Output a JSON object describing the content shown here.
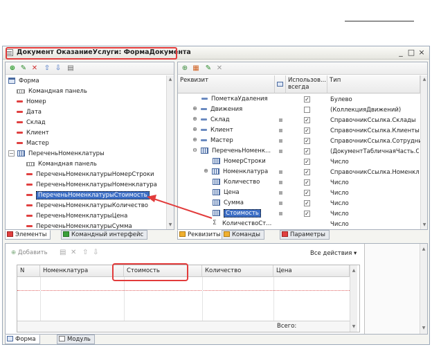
{
  "window": {
    "title": "Документ ОказаниеУслуги: ФормаДокумента",
    "minimize": "_",
    "maximize": "□",
    "close": "×"
  },
  "tree": {
    "items": [
      {
        "label": "Форма",
        "icon": "form-icon"
      },
      {
        "label": "Командная панель",
        "icon": "command-panel-icon"
      },
      {
        "label": "Номер",
        "icon": "field-icon"
      },
      {
        "label": "Дата",
        "icon": "field-icon"
      },
      {
        "label": "Склад",
        "icon": "field-icon"
      },
      {
        "label": "Клиент",
        "icon": "field-icon"
      },
      {
        "label": "Мастер",
        "icon": "field-icon"
      },
      {
        "label": "ПереченьНоменклатуры",
        "icon": "table-icon"
      },
      {
        "label": "Командная панель",
        "icon": "command-panel-icon"
      },
      {
        "label": "ПереченьНоменклатурыНомерСтроки",
        "icon": "field-icon"
      },
      {
        "label": "ПереченьНоменклатурыНоменклатура",
        "icon": "field-icon"
      },
      {
        "label": "ПереченьНоменклатурыСтоимость",
        "icon": "field-icon"
      },
      {
        "label": "ПереченьНоменклатурыКоличество",
        "icon": "field-icon"
      },
      {
        "label": "ПереченьНоменклатурыЦена",
        "icon": "field-icon"
      },
      {
        "label": "ПереченьНоменклатурыСумма",
        "icon": "field-icon"
      }
    ]
  },
  "left_tabs": {
    "elements": "Элементы",
    "command_interface": "Командный интерфейс"
  },
  "attributes": {
    "headers": {
      "name": "Реквизит",
      "use": "Использов... всегда",
      "type": "Тип"
    },
    "rows": [
      {
        "name": "ПометкаУдаления",
        "type": "Булево"
      },
      {
        "name": "Движения",
        "type": "(КоллекцияДвижений)"
      },
      {
        "name": "Склад",
        "type": "СправочникСсылка.Склады"
      },
      {
        "name": "Клиент",
        "type": "СправочникСсылка.Клиенты"
      },
      {
        "name": "Мастер",
        "type": "СправочникСсылка.Сотрудни..."
      },
      {
        "name": "ПереченьНоменк...",
        "type": "(ДокументТабличнаяЧасть.О..."
      },
      {
        "name": "НомерСтроки",
        "type": "Число"
      },
      {
        "name": "Номенклатура",
        "type": "СправочникСсылка.Номенкл..."
      },
      {
        "name": "Количество",
        "type": "Число"
      },
      {
        "name": "Цена",
        "type": "Число"
      },
      {
        "name": "Сумма",
        "type": "Число"
      },
      {
        "name": "Стоимость",
        "type": "Число"
      },
      {
        "name": "КоличествоСт...",
        "type": "Число"
      }
    ]
  },
  "right_tabs": {
    "requisites": "Реквизиты",
    "commands": "Команды",
    "parameters": "Параметры"
  },
  "bottom": {
    "add": "Добавить",
    "all_actions": "Все действия ▾",
    "columns": [
      "N",
      "Номенклатура",
      "Стоимость",
      "Количество",
      "Цена"
    ],
    "total": "Всего:"
  },
  "bottom_tabs": {
    "form": "Форма",
    "module": "Модуль"
  },
  "colors": {
    "accent": "#3d6fc6",
    "highlight": "#e23b3b"
  }
}
